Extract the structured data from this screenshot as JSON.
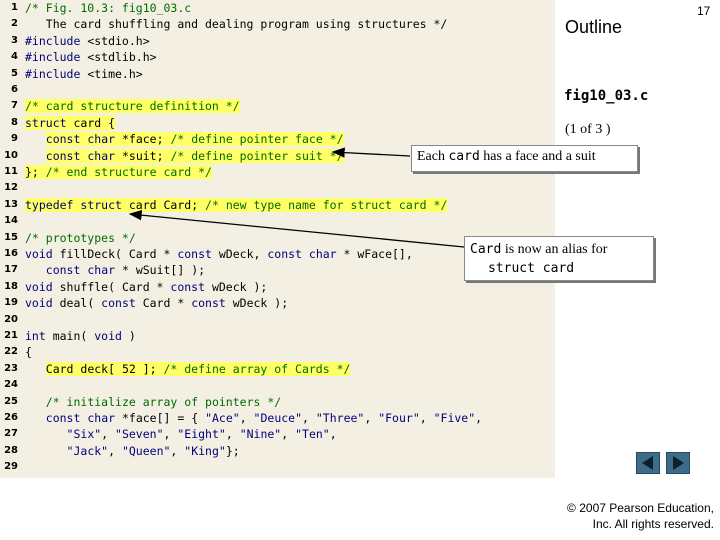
{
  "page_number": "17",
  "outline_title": "Outline",
  "figure_name": "fig10_03.c",
  "page_of": "(1 of 3 )",
  "callout1": "Each card has a face and a suit",
  "callout1_parts": {
    "pre": "Each ",
    "mono": "card",
    "post": " has a face and a suit"
  },
  "callout2_parts": {
    "mono1": "Card",
    "post": " is now an alias for",
    "mono2": "struct card"
  },
  "copyright_lines": [
    "© 2007 Pearson Education,",
    "Inc. All rights reserved."
  ],
  "icons": {
    "prev": "previous-slide-icon",
    "next": "next-slide-icon"
  },
  "colors": {
    "code_bg": "#f3f0e3",
    "highlight": "#ffff66",
    "comment": "#006b00",
    "keyword": "#00007a",
    "nav": "#3d6b8a"
  },
  "code_lines": [
    {
      "n": "1",
      "text": "/* Fig. 10.3: fig10_03.c"
    },
    {
      "n": "2",
      "text": "   The card shuffling and dealing program using structures */"
    },
    {
      "n": "3",
      "text": "#include <stdio.h>"
    },
    {
      "n": "4",
      "text": "#include <stdlib.h>"
    },
    {
      "n": "5",
      "text": "#include <time.h>"
    },
    {
      "n": "6",
      "text": ""
    },
    {
      "n": "7",
      "text": "/* card structure definition */"
    },
    {
      "n": "8",
      "text": "struct card {"
    },
    {
      "n": "9",
      "text": "   const char *face; /* define pointer face */"
    },
    {
      "n": "10",
      "text": "   const char *suit; /* define pointer suit */"
    },
    {
      "n": "11",
      "text": "}; /* end structure card */"
    },
    {
      "n": "12",
      "text": ""
    },
    {
      "n": "13",
      "text": "typedef struct card Card; /* new type name for struct card */"
    },
    {
      "n": "14",
      "text": ""
    },
    {
      "n": "15",
      "text": "/* prototypes */"
    },
    {
      "n": "16",
      "text": "void fillDeck( Card * const wDeck, const char * wFace[],"
    },
    {
      "n": "17",
      "text": "   const char * wSuit[] );"
    },
    {
      "n": "18",
      "text": "void shuffle( Card * const wDeck );"
    },
    {
      "n": "19",
      "text": "void deal( const Card * const wDeck );"
    },
    {
      "n": "20",
      "text": ""
    },
    {
      "n": "21",
      "text": "int main( void )"
    },
    {
      "n": "22",
      "text": "{"
    },
    {
      "n": "23",
      "text": "   Card deck[ 52 ]; /* define array of Cards */"
    },
    {
      "n": "24",
      "text": ""
    },
    {
      "n": "25",
      "text": "   /* initialize array of pointers */"
    },
    {
      "n": "26",
      "text": "   const char *face[] = { \"Ace\", \"Deuce\", \"Three\", \"Four\", \"Five\","
    },
    {
      "n": "27",
      "text": "      \"Six\", \"Seven\", \"Eight\", \"Nine\", \"Ten\","
    },
    {
      "n": "28",
      "text": "      \"Jack\", \"Queen\", \"King\"};"
    },
    {
      "n": "29",
      "text": ""
    }
  ]
}
